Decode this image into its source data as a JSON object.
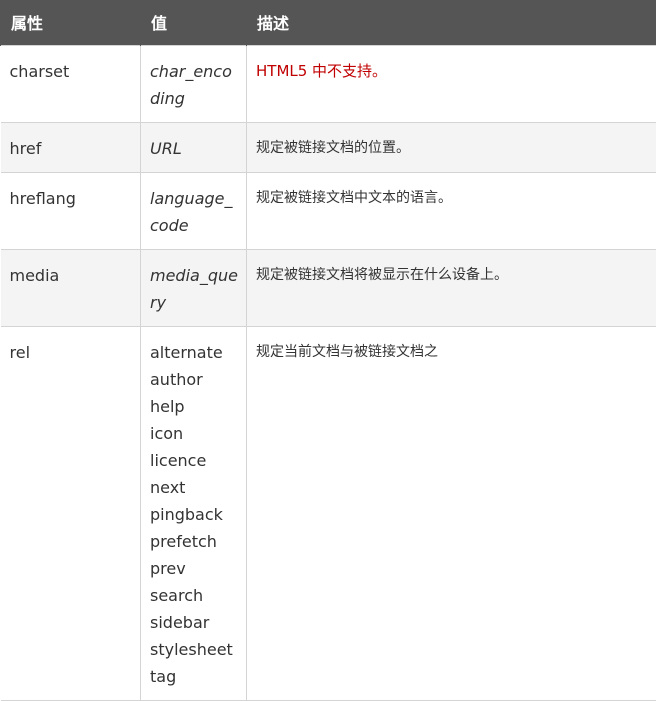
{
  "header": {
    "attribute": "属性",
    "value": "值",
    "description": "描述"
  },
  "rows": [
    {
      "attribute": "charset",
      "value": "char_encoding",
      "description": "HTML5 中不支持。",
      "description_color": "#c00000"
    },
    {
      "attribute": "href",
      "value": "URL",
      "description": "规定被链接文档的位置。"
    },
    {
      "attribute": "hreflang",
      "value": "language_code",
      "description": "规定被链接文档中文本的语言。"
    },
    {
      "attribute": "media",
      "value": "media_query",
      "description": "规定被链接文档将被显示在什么设备上。"
    },
    {
      "attribute": "rel",
      "values": [
        "alternate",
        "author",
        "help",
        "icon",
        "licence",
        "next",
        "pingback",
        "prefetch",
        "prev",
        "search",
        "sidebar",
        "stylesheet",
        "tag"
      ],
      "description": "规定当前文档与被链接文档之"
    }
  ]
}
